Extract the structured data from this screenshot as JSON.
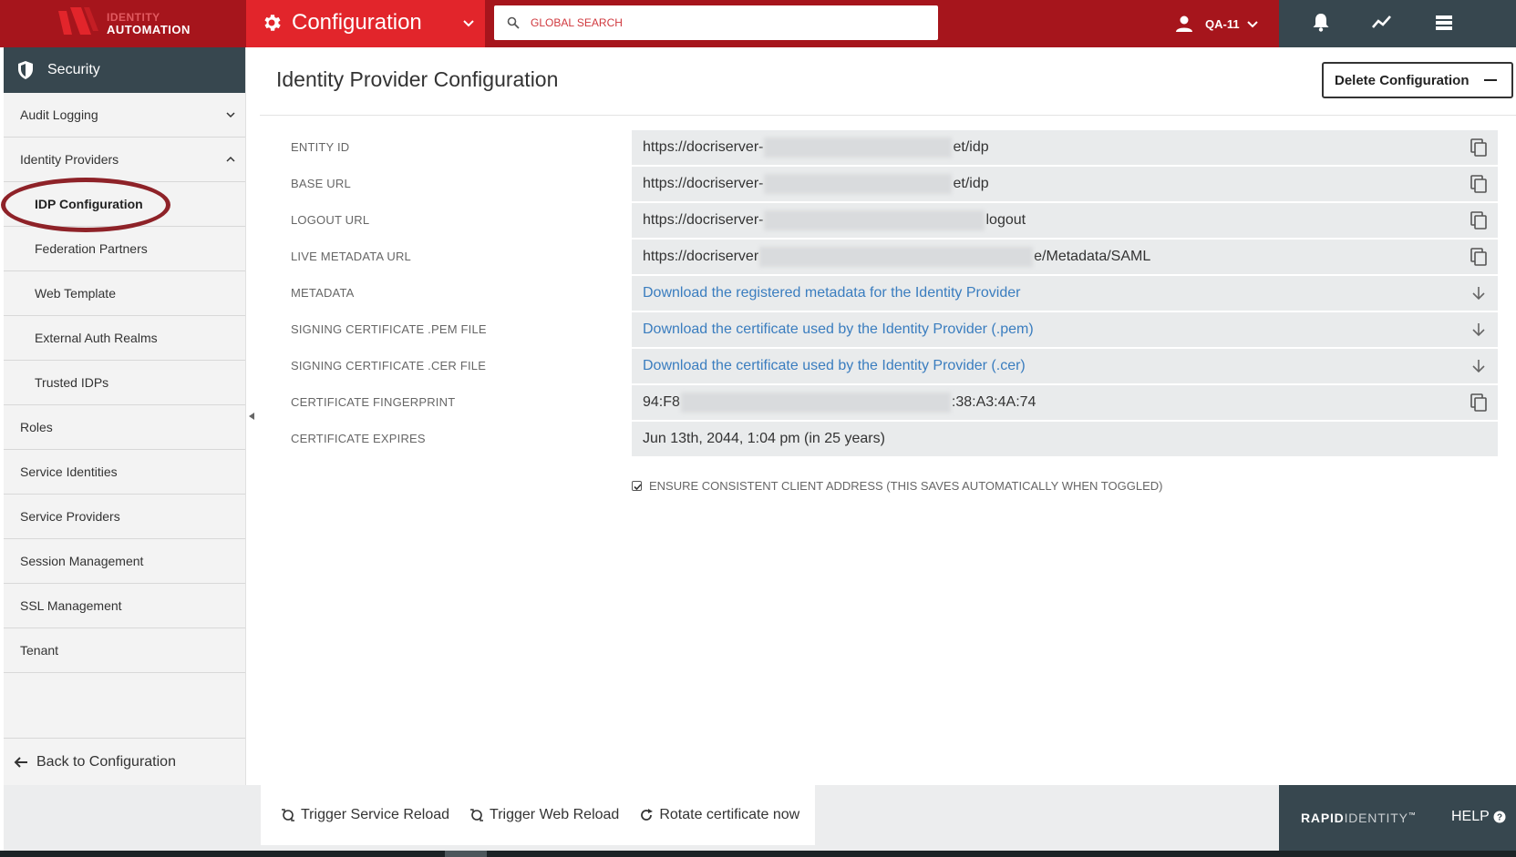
{
  "brand": {
    "logo_line1": "IDENTITY",
    "logo_line2": "AUTOMATION",
    "footer_bold": "RAPID",
    "footer_light": "IDENTITY",
    "footer_tm": "™"
  },
  "topbar": {
    "module_label": "Configuration",
    "search_placeholder": "GLOBAL SEARCH",
    "username": "QA-11",
    "icons": [
      "user-icon",
      "bell-icon",
      "trend-icon",
      "list-icon"
    ]
  },
  "sidebar": {
    "header": "Security",
    "items": [
      {
        "label": "Audit Logging",
        "level": "top",
        "caret": "down"
      },
      {
        "label": "Identity Providers",
        "level": "top",
        "caret": "up"
      },
      {
        "label": "IDP Configuration",
        "level": "sub",
        "active": true
      },
      {
        "label": "Federation Partners",
        "level": "sub"
      },
      {
        "label": "Web Template",
        "level": "sub"
      },
      {
        "label": "External Auth Realms",
        "level": "sub"
      },
      {
        "label": "Trusted IDPs",
        "level": "sub"
      },
      {
        "label": "Roles",
        "level": "top"
      },
      {
        "label": "Service Identities",
        "level": "top"
      },
      {
        "label": "Service Providers",
        "level": "top"
      },
      {
        "label": "Session Management",
        "level": "top"
      },
      {
        "label": "SSL Management",
        "level": "top"
      },
      {
        "label": "Tenant",
        "level": "top"
      }
    ],
    "back_label": "Back to Configuration"
  },
  "main": {
    "title": "Identity Provider Configuration",
    "delete_label": "Delete Configuration",
    "fields": [
      {
        "label": "ENTITY ID",
        "prefix": "https://docriserver-",
        "suffix": "et/idp",
        "kind": "copy"
      },
      {
        "label": "BASE URL",
        "prefix": "https://docriserver-",
        "suffix": "et/idp",
        "kind": "copy"
      },
      {
        "label": "LOGOUT URL",
        "prefix": "https://docriserver-",
        "suffix": "logout",
        "kind": "copy"
      },
      {
        "label": "LIVE METADATA URL",
        "prefix": "https://docriserver",
        "suffix": "e/Metadata/SAML",
        "kind": "copy"
      },
      {
        "label": "METADATA",
        "text": "Download the registered metadata for the Identity Provider",
        "kind": "download"
      },
      {
        "label": "SIGNING CERTIFICATE .PEM FILE",
        "text": "Download the certificate used by the Identity Provider (.pem)",
        "kind": "download"
      },
      {
        "label": "SIGNING CERTIFICATE .CER FILE",
        "text": "Download the certificate used by the Identity Provider (.cer)",
        "kind": "download"
      },
      {
        "label": "CERTIFICATE FINGERPRINT",
        "prefix": "94:F8",
        "suffix": ":38:A3:4A:74",
        "kind": "copy"
      },
      {
        "label": "CERTIFICATE EXPIRES",
        "text": "Jun 13th, 2044, 1:04 pm (in 25 years)",
        "kind": "plain"
      }
    ],
    "ensure_checkbox": {
      "label": "ENSURE CONSISTENT CLIENT ADDRESS (THIS SAVES AUTOMATICALLY WHEN TOGGLED)",
      "checked": true
    }
  },
  "footer": {
    "actions": [
      "Trigger Service Reload",
      "Trigger Web Reload",
      "Rotate certificate now"
    ],
    "help_label": "HELP"
  },
  "colors": {
    "topbar_red": "#a6151c",
    "module_red": "#e2252b",
    "dark_slate": "#37474f",
    "link_blue": "#3a7dbf",
    "field_bg": "#e9ebec"
  }
}
